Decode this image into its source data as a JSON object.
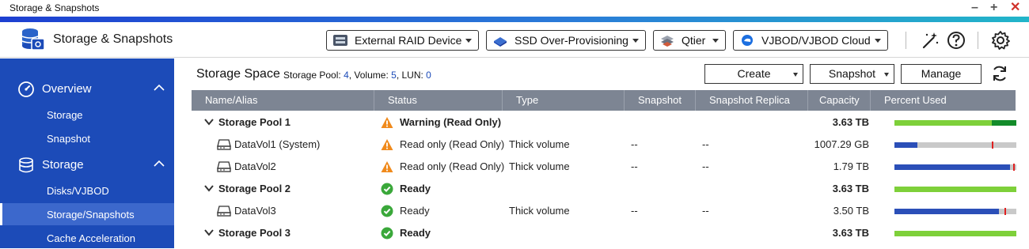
{
  "window": {
    "title": "Storage & Snapshots",
    "controls": [
      "–",
      "+",
      "✕"
    ]
  },
  "header": {
    "app_name": "Storage & Snapshots",
    "buttons": [
      {
        "label": "External RAID Device",
        "icon": "raid-device-icon"
      },
      {
        "label": "SSD Over-Provisioning",
        "icon": "ssd-icon"
      },
      {
        "label": "Qtier",
        "icon": "qtier-icon"
      },
      {
        "label": "VJBOD/VJBOD Cloud",
        "icon": "vjbod-cloud-icon"
      }
    ],
    "icons": [
      "magic-wand-icon",
      "help-icon",
      "gear-icon"
    ]
  },
  "sidebar": {
    "sections": [
      {
        "label": "Overview",
        "icon": "speedometer-icon",
        "items": [
          "Storage",
          "Snapshot"
        ]
      },
      {
        "label": "Storage",
        "icon": "database-icon",
        "items": [
          "Disks/VJBOD",
          "Storage/Snapshots",
          "Cache Acceleration"
        ]
      }
    ],
    "active_item": "Storage/Snapshots"
  },
  "main": {
    "title": "Storage Space",
    "summary": {
      "pool_label": "Storage Pool:",
      "pool_count": "4",
      "volume_label": ", Volume:",
      "volume_count": "5",
      "lun_label": ", LUN:",
      "lun_count": "0"
    },
    "actions": {
      "create": "Create",
      "snapshot": "Snapshot",
      "manage": "Manage"
    },
    "columns": [
      "Name/Alias",
      "Status",
      "Type",
      "Snapshot",
      "Snapshot Replica",
      "Capacity",
      "Percent Used"
    ],
    "rows": [
      {
        "kind": "pool",
        "name": "Storage Pool 1",
        "status": "Warning (Read Only)",
        "status_type": "warning",
        "type": "",
        "snapshot": "",
        "replica": "",
        "capacity": "3.63 TB",
        "used": 0.88,
        "used_color": "#7ed03a",
        "extra_color": "#138b2a",
        "extra_start": 0.8,
        "marker": null
      },
      {
        "kind": "volume",
        "name": "DataVol1 (System)",
        "status": "Read only",
        "status_extra": "(Read Only)",
        "status_type": "warning",
        "type": "Thick volume",
        "snapshot": "--",
        "replica": "--",
        "capacity": "1007.29 GB",
        "used": 0.19,
        "used_color": "#2b4fb8",
        "marker": 0.8
      },
      {
        "kind": "volume",
        "name": "DataVol2",
        "status": "Read only",
        "status_extra": "(Read Only)",
        "status_type": "warning",
        "type": "Thick volume",
        "snapshot": "--",
        "replica": "--",
        "capacity": "1.79 TB",
        "used": 0.95,
        "used_color": "#2b4fb8",
        "marker": 0.975
      },
      {
        "kind": "pool",
        "name": "Storage Pool 2",
        "status": "Ready",
        "status_type": "ready",
        "type": "",
        "snapshot": "",
        "replica": "",
        "capacity": "3.63 TB",
        "used": 1.0,
        "used_color": "#7ed03a",
        "marker": null
      },
      {
        "kind": "volume",
        "name": "DataVol3",
        "status": "Ready",
        "status_type": "ready",
        "type": "Thick volume",
        "snapshot": "--",
        "replica": "--",
        "capacity": "3.50 TB",
        "used": 0.86,
        "used_color": "#2b4fb8",
        "marker": 0.9
      },
      {
        "kind": "pool",
        "name": "Storage Pool 3",
        "status": "Ready",
        "status_type": "ready",
        "type": "",
        "snapshot": "",
        "replica": "",
        "capacity": "3.63 TB",
        "used": 1.0,
        "used_color": "#7ed03a",
        "marker": null
      }
    ]
  }
}
